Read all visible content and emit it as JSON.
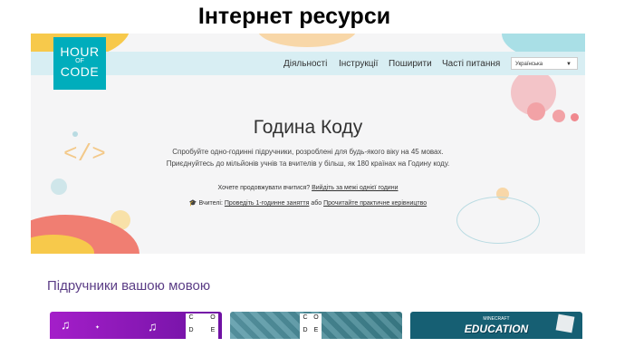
{
  "slide": {
    "title": "Інтернет ресурси"
  },
  "logo": {
    "line1": "HOUR",
    "line2": "OF",
    "line3": "CODE"
  },
  "nav": {
    "items": [
      "Діяльності",
      "Інструкції",
      "Поширити",
      "Часті питання"
    ],
    "language": "Українська"
  },
  "hero": {
    "title": "Година Коду",
    "desc_line1": "Спробуйте одно-годинні підручники, розроблені для будь-якого віку на 45 мовах.",
    "desc_line2": "Приєднуйтесь до мільйонів учнів та вчителів у більш, як 180 країнах на Годину коду.",
    "more_prefix": "Хочете продовжувати вчитися?",
    "more_link": "Вийдіть за межі однієї години",
    "teachers_prefix": "Вчителі:",
    "teachers_link1": "Проведіть 1-годинне заняття",
    "teachers_or": "або",
    "teachers_link2": "Прочитайте практичне керівництво"
  },
  "section": {
    "heading": "Підручники вашою мовою"
  },
  "cards": {
    "code_letters_1": [
      "C",
      "O",
      "D",
      "E"
    ],
    "code_letters_2": [
      "C",
      "O",
      "D",
      "E"
    ],
    "minecraft_small": "MINECRAFT",
    "minecraft_big": "EDUCATION"
  },
  "colors": {
    "logo": "#00adbc",
    "nav_band": "#d8eef3",
    "section_heading": "#5b3d86",
    "card_purple": "#a41ec9",
    "card_teal": "#3b7f8b",
    "card_minecraft": "#165f73"
  }
}
